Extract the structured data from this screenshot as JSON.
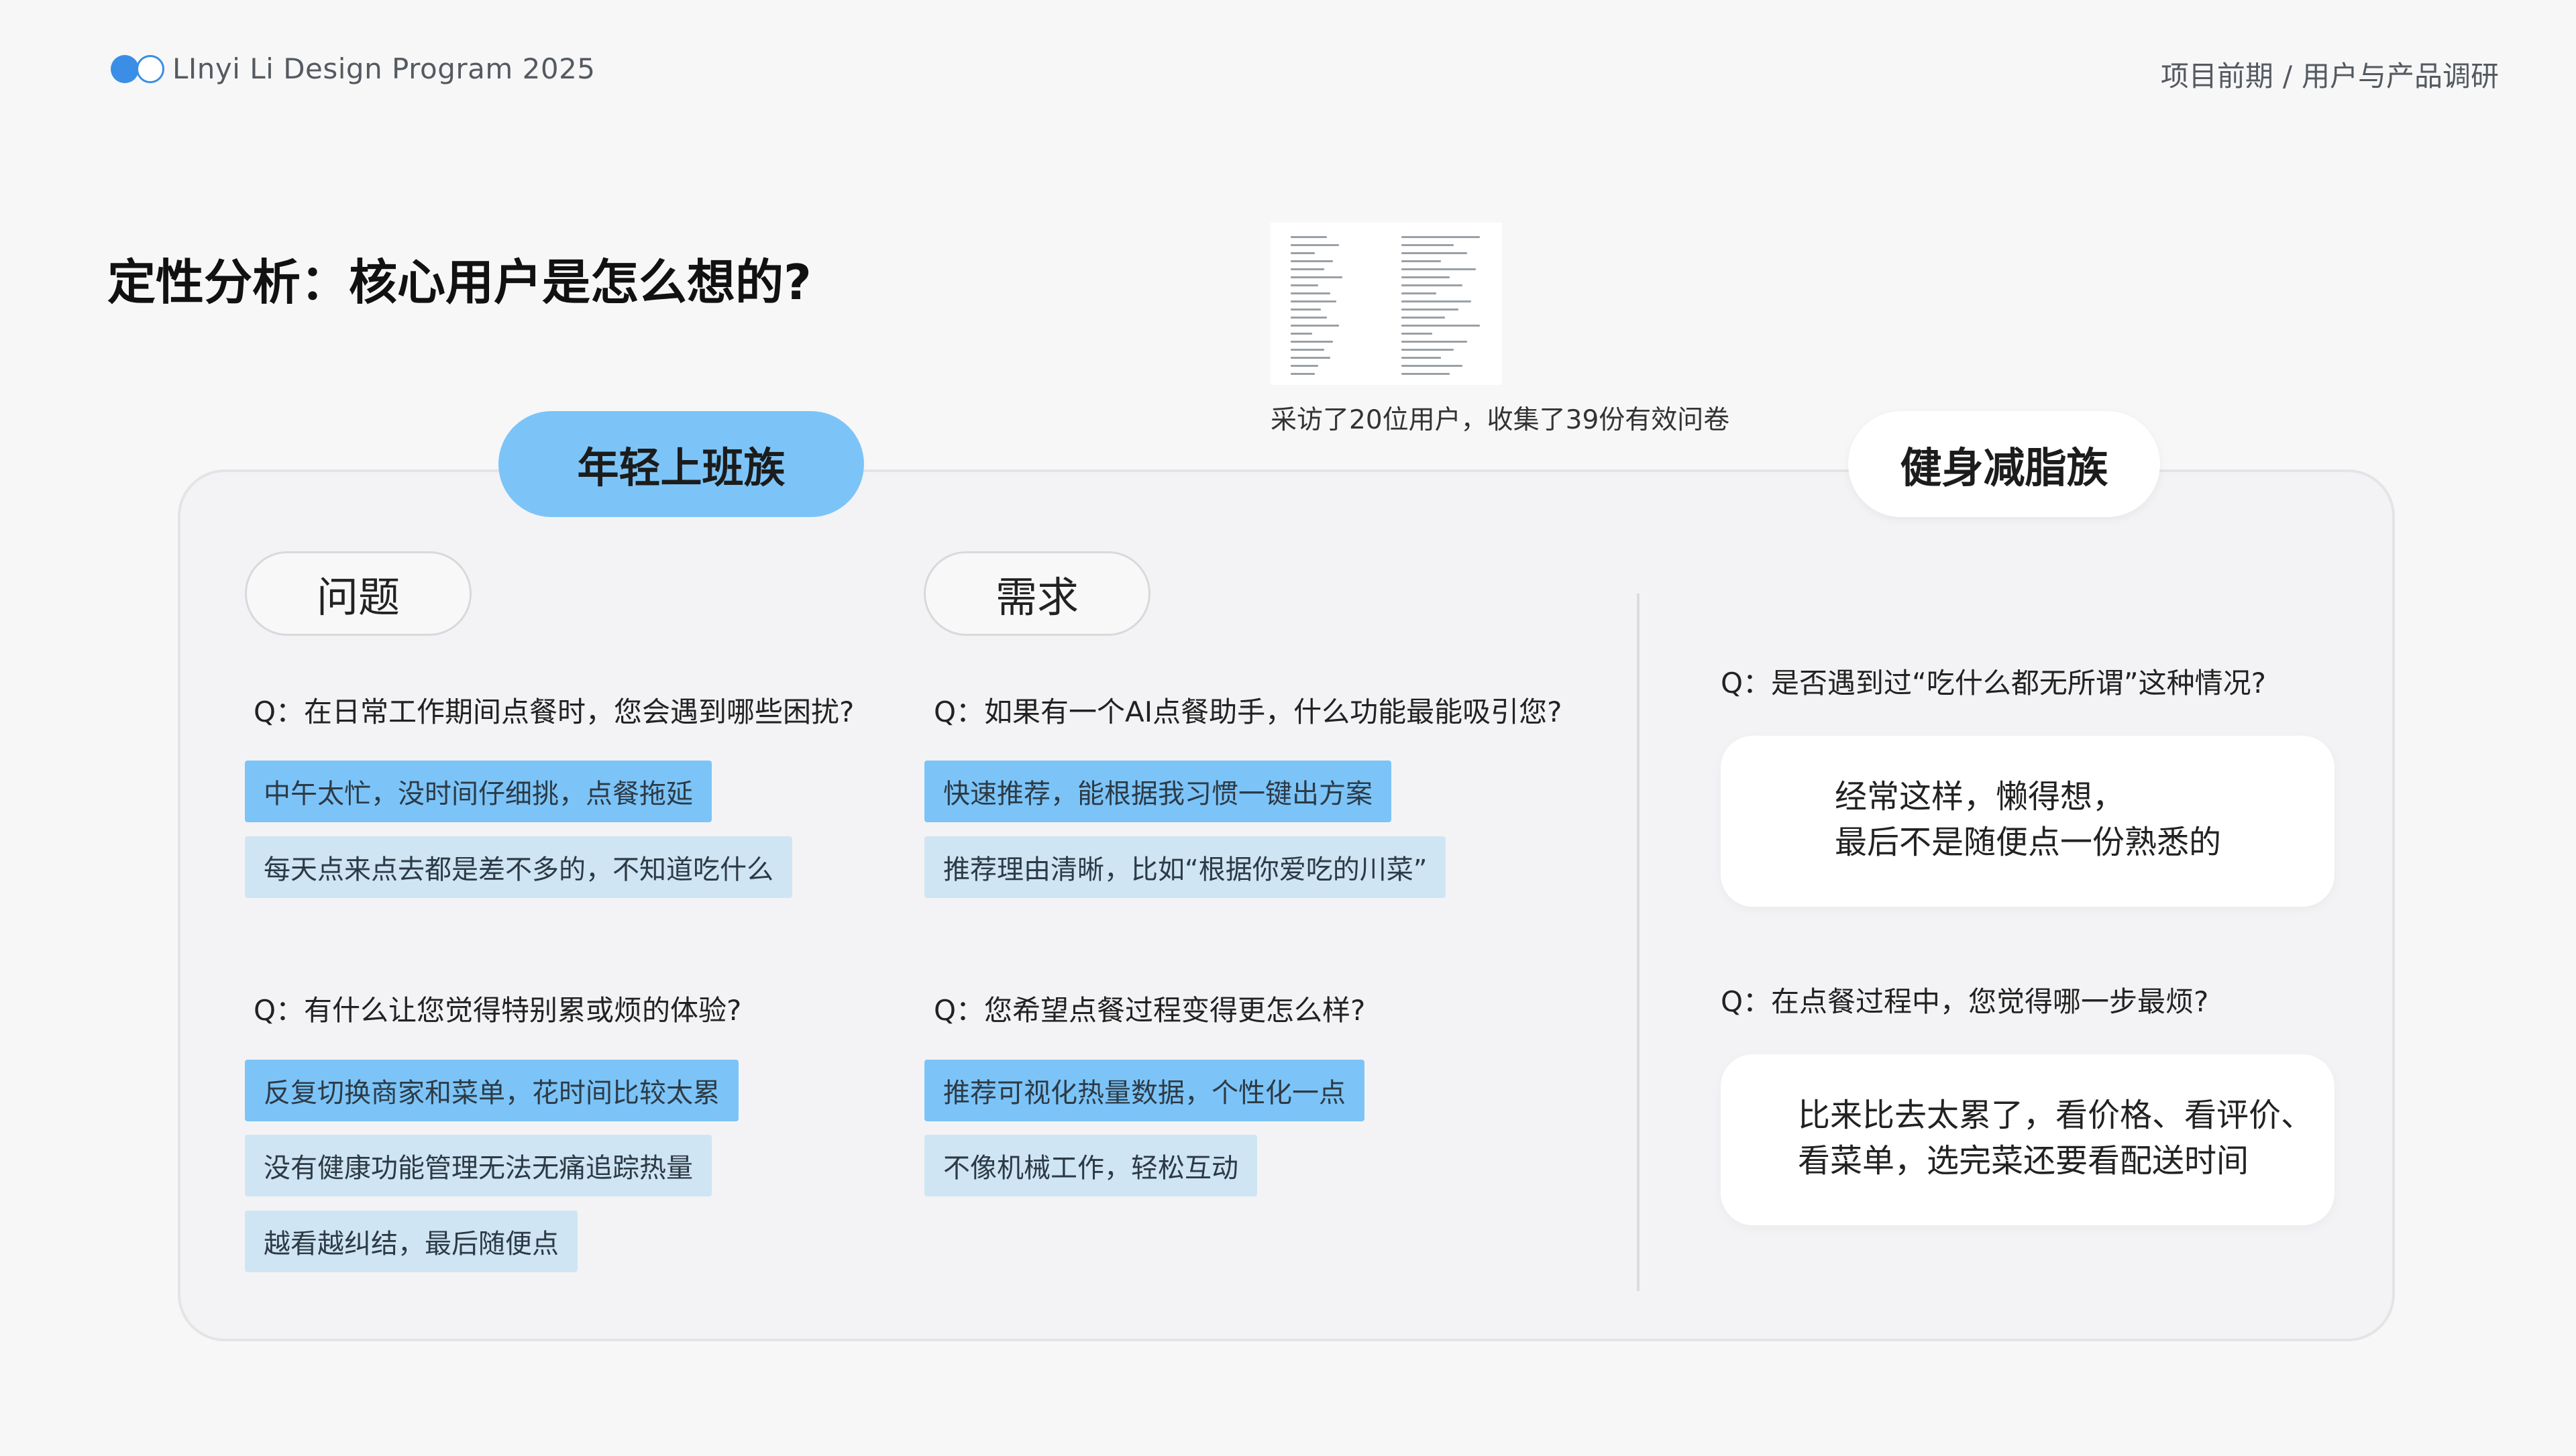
{
  "header": {
    "brand": "LInyi Li Design Program 2025",
    "breadcrumb": [
      "项目前期",
      "/",
      "用户与产品调研"
    ]
  },
  "title": "定性分析：核心用户是怎么想的?",
  "survey": {
    "caption": "采访了20位用户，收集了39份有效问卷"
  },
  "groups": {
    "young_workers": {
      "label": "年轻上班族",
      "problems": {
        "label": "问题",
        "q1": {
          "question": "Q：在日常工作期间点餐时，您会遇到哪些困扰?",
          "answers": [
            "中午太忙，没时间仔细挑，点餐拖延",
            "每天点来点去都是差不多的，不知道吃什么"
          ]
        },
        "q2": {
          "question": "Q：有什么让您觉得特别累或烦的体验?",
          "answers": [
            "反复切换商家和菜单，花时间比较太累",
            "没有健康功能管理无法无痛追踪热量",
            "越看越纠结，最后随便点"
          ]
        }
      },
      "needs": {
        "label": "需求",
        "q1": {
          "question": "Q：如果有一个AI点餐助手，什么功能最能吸引您?",
          "answers": [
            "快速推荐，能根据我习惯一键出方案",
            "推荐理由清晰，比如“根据你爱吃的川菜”"
          ]
        },
        "q2": {
          "question": "Q：您希望点餐过程变得更怎么样?",
          "answers": [
            "推荐可视化热量数据，个性化一点",
            "不像机械工作，轻松互动"
          ]
        }
      }
    },
    "fitness": {
      "label": "健身减脂族",
      "q1": {
        "question": "Q：是否遇到过“吃什么都无所谓”这种情况?",
        "answer": [
          "经常这样，懒得想，",
          "最后不是随便点一份熟悉的"
        ]
      },
      "q2": {
        "question": "Q：在点餐过程中，您觉得哪一步最烦?",
        "answer": [
          "比来比去太累了，看价格、看评价、",
          "看菜单，选完菜还要看配送时间"
        ]
      }
    }
  },
  "colors": {
    "accent": "#7cc4f8",
    "accent_soft": "#cfe5f3",
    "brand_dot": "#3a8ee6"
  }
}
